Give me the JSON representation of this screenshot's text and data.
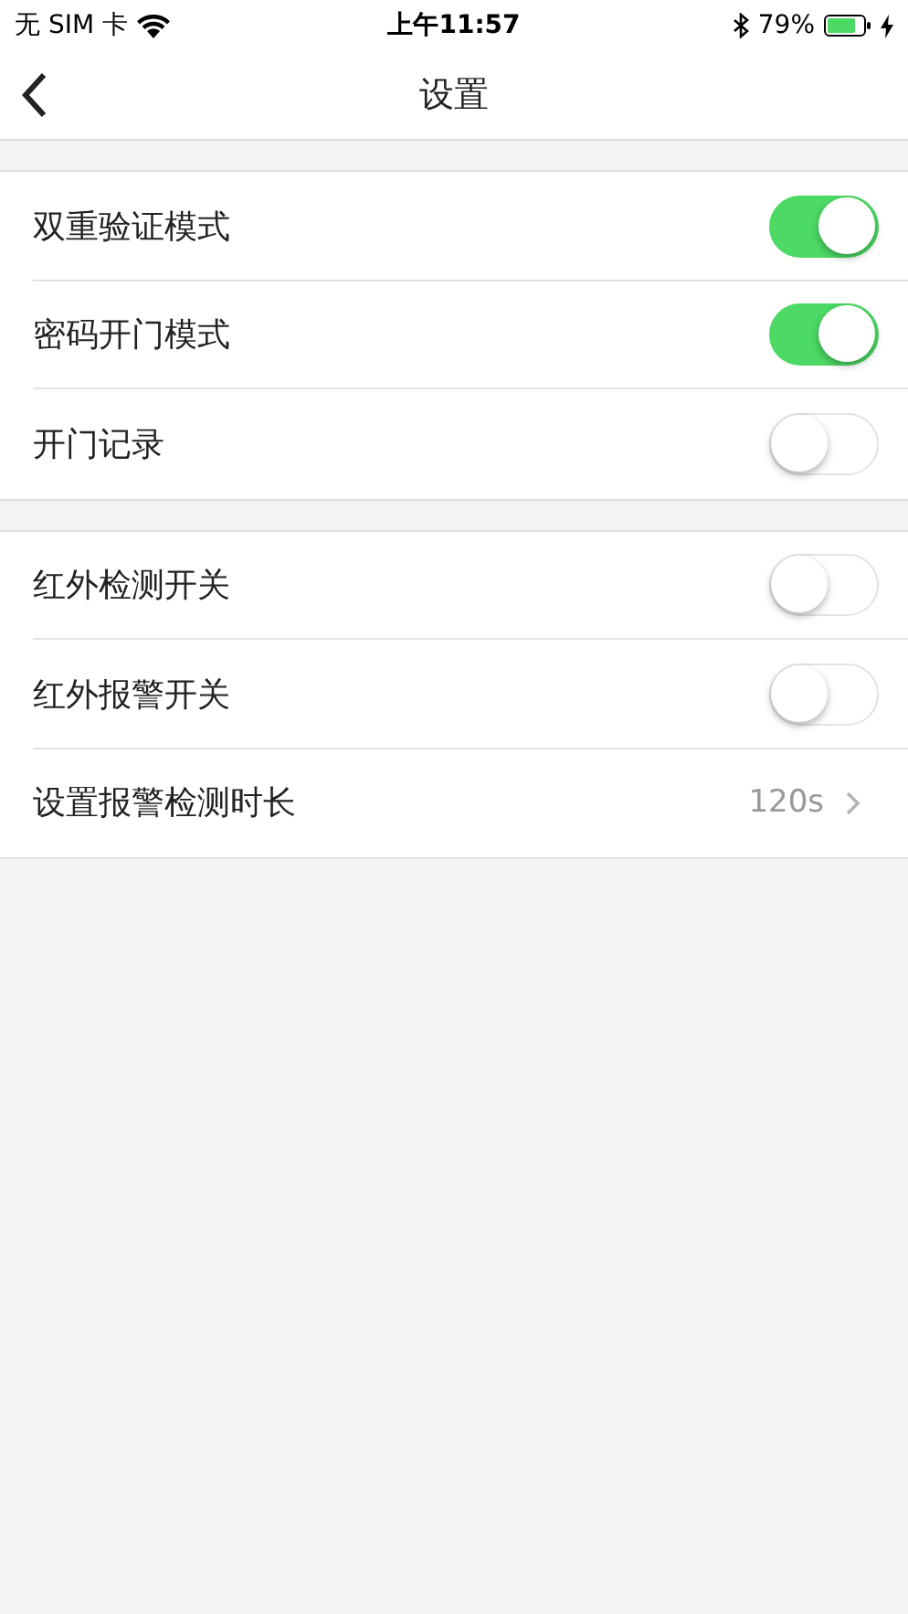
{
  "status_bar": {
    "carrier": "无 SIM 卡",
    "time": "上午11:57",
    "battery": "79%"
  },
  "nav": {
    "title": "设置"
  },
  "sections": [
    {
      "rows": [
        {
          "kind": "toggle",
          "label": "双重验证模式",
          "on": true
        },
        {
          "kind": "toggle",
          "label": "密码开门模式",
          "on": true
        },
        {
          "kind": "toggle",
          "label": "开门记录",
          "on": false
        }
      ]
    },
    {
      "rows": [
        {
          "kind": "toggle",
          "label": "红外检测开关",
          "on": false
        },
        {
          "kind": "toggle",
          "label": "红外报警开关",
          "on": false
        },
        {
          "kind": "value",
          "label": "设置报警检测时长",
          "value": "120s"
        }
      ]
    }
  ]
}
